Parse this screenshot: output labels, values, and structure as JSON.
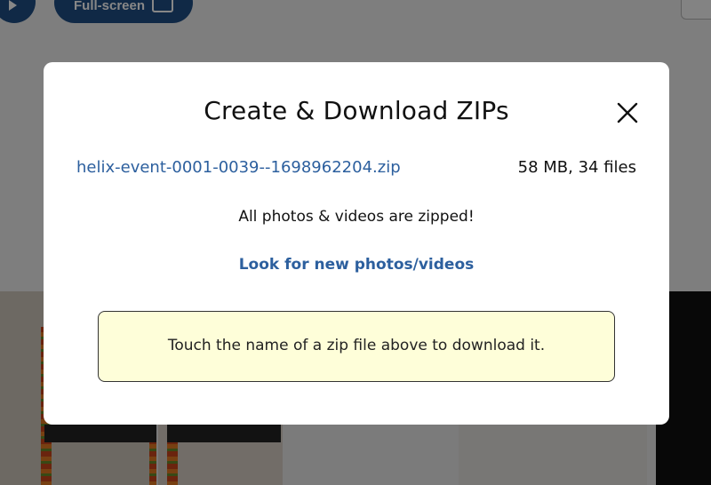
{
  "background": {
    "fullscreen_label": "Full-screen"
  },
  "modal": {
    "title": "Create & Download ZIPs",
    "close_icon": "close-icon",
    "zip_file": {
      "name": "helix-event-0001-0039--1698962204.zip",
      "meta": "58 MB, 34 files"
    },
    "status": "All photos & videos are zipped!",
    "refresh_label": "Look for new photos/videos",
    "hint": "Touch the name of a zip file above to download it."
  },
  "colors": {
    "accent": "#2c5f9e",
    "hint_background": "#fefed9",
    "header_button": "#1f4f85"
  }
}
